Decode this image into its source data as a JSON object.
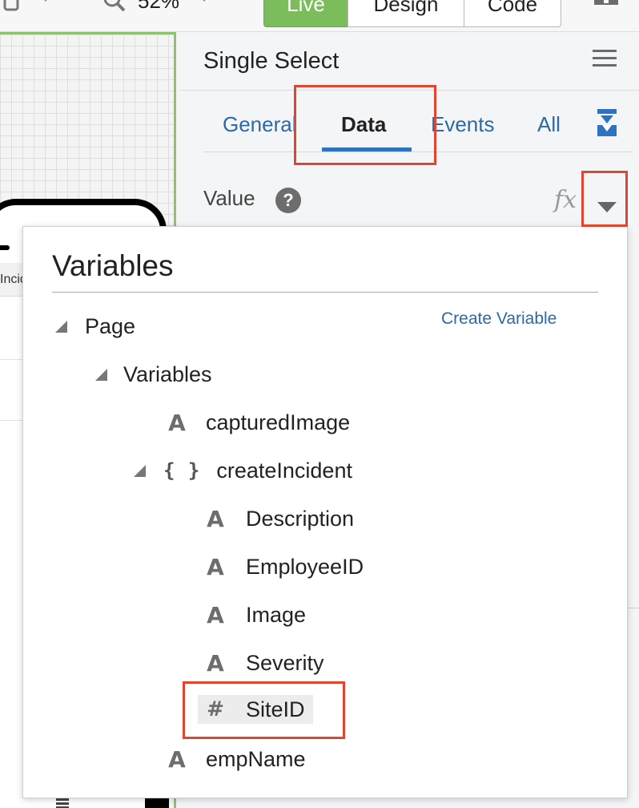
{
  "toolbar": {
    "zoom": "52%",
    "modes": {
      "live": "Live",
      "design": "Design",
      "code": "Code"
    },
    "colors": {
      "live_active": "#7bbd5b"
    }
  },
  "canvas": {
    "tab_text": "Incid"
  },
  "panel": {
    "title": "Single Select",
    "tabs": {
      "general": "General",
      "data": "Data",
      "events": "Events",
      "all": "All"
    },
    "active_tab": "Data",
    "value_label": "Value",
    "help_glyph": "?",
    "fx_glyph": "fx"
  },
  "popup": {
    "title": "Variables",
    "create_link": "Create Variable",
    "tree": {
      "page": "Page",
      "variables": "Variables",
      "capturedImage": "capturedImage",
      "createIncident": "createIncident",
      "description": "Description",
      "employeeID": "EmployeeID",
      "image": "Image",
      "severity": "Severity",
      "siteID": "SiteID",
      "empName": "empName"
    },
    "glyphs": {
      "string": "A",
      "object": "{ }",
      "number": "#"
    }
  },
  "highlight_color": "#e1452f"
}
